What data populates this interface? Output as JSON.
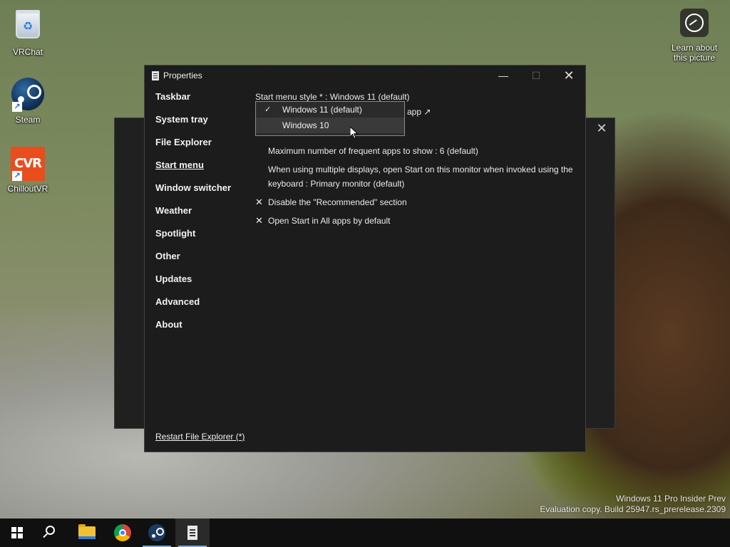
{
  "desktop": {
    "icons": [
      {
        "label": "VRChat",
        "icon": "recycle-bin-icon"
      },
      {
        "label": "Steam",
        "icon": "steam-icon"
      },
      {
        "label": "ChilloutVR",
        "icon": "chilloutvr-icon",
        "art_text": "CVR"
      }
    ],
    "learn": {
      "line1": "Learn about",
      "line2": "this picture",
      "icon": "camera-info-icon"
    }
  },
  "window": {
    "title": "Properties",
    "minimize": "—",
    "maximize": "☐",
    "close": "✕",
    "nav": [
      {
        "label": "Taskbar"
      },
      {
        "label": "System tray"
      },
      {
        "label": "File Explorer"
      },
      {
        "label": "Start menu",
        "active": true
      },
      {
        "label": "Window switcher"
      },
      {
        "label": "Weather"
      },
      {
        "label": "Spotlight"
      },
      {
        "label": "Other"
      },
      {
        "label": "Updates"
      },
      {
        "label": "Advanced"
      },
      {
        "label": "About"
      }
    ],
    "restart_link": "Restart File Explorer (*)",
    "settings": {
      "start_menu_style": "Start menu style * : Windows 11 (default)",
      "partial_link": "app ↗",
      "frequent_apps": "Maximum number of frequent apps to show : 6 (default)",
      "multi_display": "When using multiple displays, open Start on this monitor when invoked using the keyboard : Primary monitor (default)",
      "disable_recommended": "Disable the \"Recommended\" section",
      "open_all_apps": "Open Start in All apps by default",
      "x_mark": "✕"
    },
    "dropdown": {
      "options": [
        "Windows 11 (default)",
        "Windows 10"
      ],
      "selected": "Windows 11 (default)",
      "hovered": "Windows 10",
      "check": "✓"
    }
  },
  "background_window": {
    "close": "✕"
  },
  "taskbar": {
    "items": [
      "start-icon",
      "search-icon",
      "file-explorer-icon",
      "chrome-icon",
      "steam-icon",
      "properties-icon"
    ]
  },
  "watermark": {
    "line1": "Windows 11 Pro Insider Prev",
    "line2": "Evaluation copy. Build 25947.rs_prerelease.2309"
  }
}
